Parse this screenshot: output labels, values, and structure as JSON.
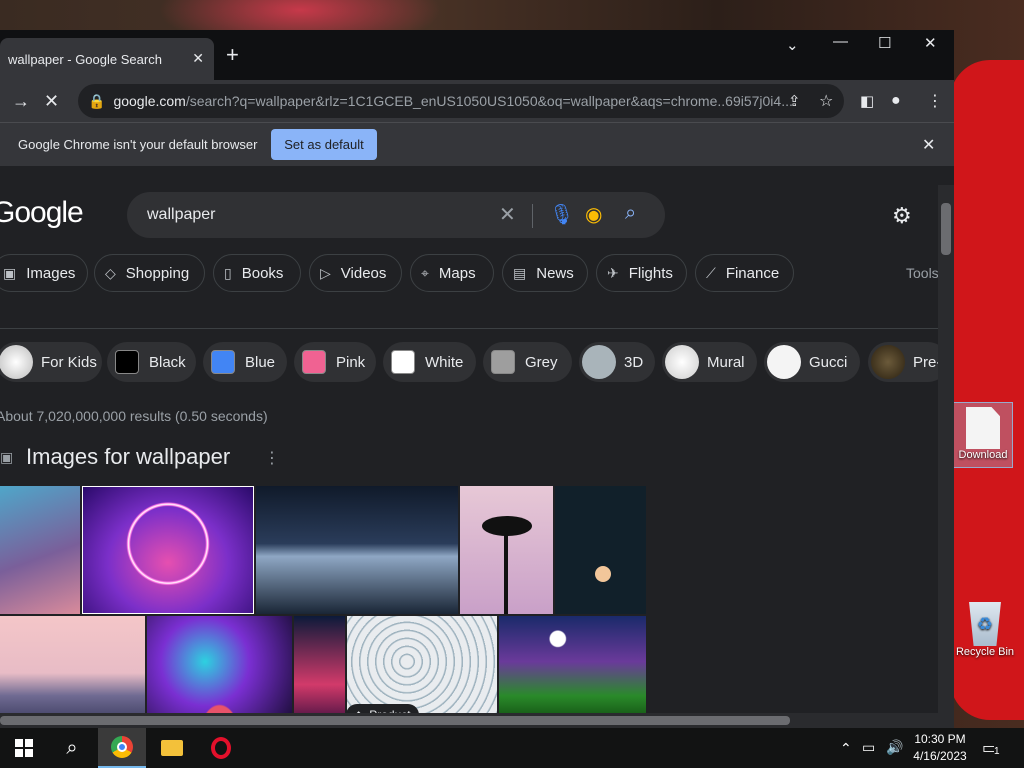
{
  "browser": {
    "tab_title": "wallpaper - Google Search",
    "url_host": "google.com",
    "url_rest": "/search?q=wallpaper&rlz=1C1GCEB_enUS1050US1050&oq=wallpaper&aqs=chrome..69i57j0i4...",
    "infobar_text": "Google Chrome isn't your default browser",
    "set_default_label": "Set as default"
  },
  "google": {
    "logo": "Google",
    "query": "wallpaper",
    "tabs": [
      "Images",
      "Shopping",
      "Books",
      "Videos",
      "Maps",
      "News",
      "Flights",
      "Finance"
    ],
    "tools_label": "Tools",
    "filters": [
      "For Kids",
      "Black",
      "Blue",
      "Pink",
      "White",
      "Grey",
      "3D",
      "Mural",
      "Gucci",
      "Pre-"
    ],
    "results_stats": "About 7,020,000,000 results (0.50 seconds)",
    "images_heading": "Images for wallpaper",
    "product_badge": "Product"
  },
  "desktop": {
    "download_label": "Download",
    "recycle_label": "Recycle Bin"
  },
  "taskbar": {
    "time": "10:30 PM",
    "date": "4/16/2023",
    "notification_count": "1"
  },
  "colors": {
    "accent": "#8ab4f8",
    "page_bg": "#202124",
    "chrome_bar": "#35363a"
  }
}
